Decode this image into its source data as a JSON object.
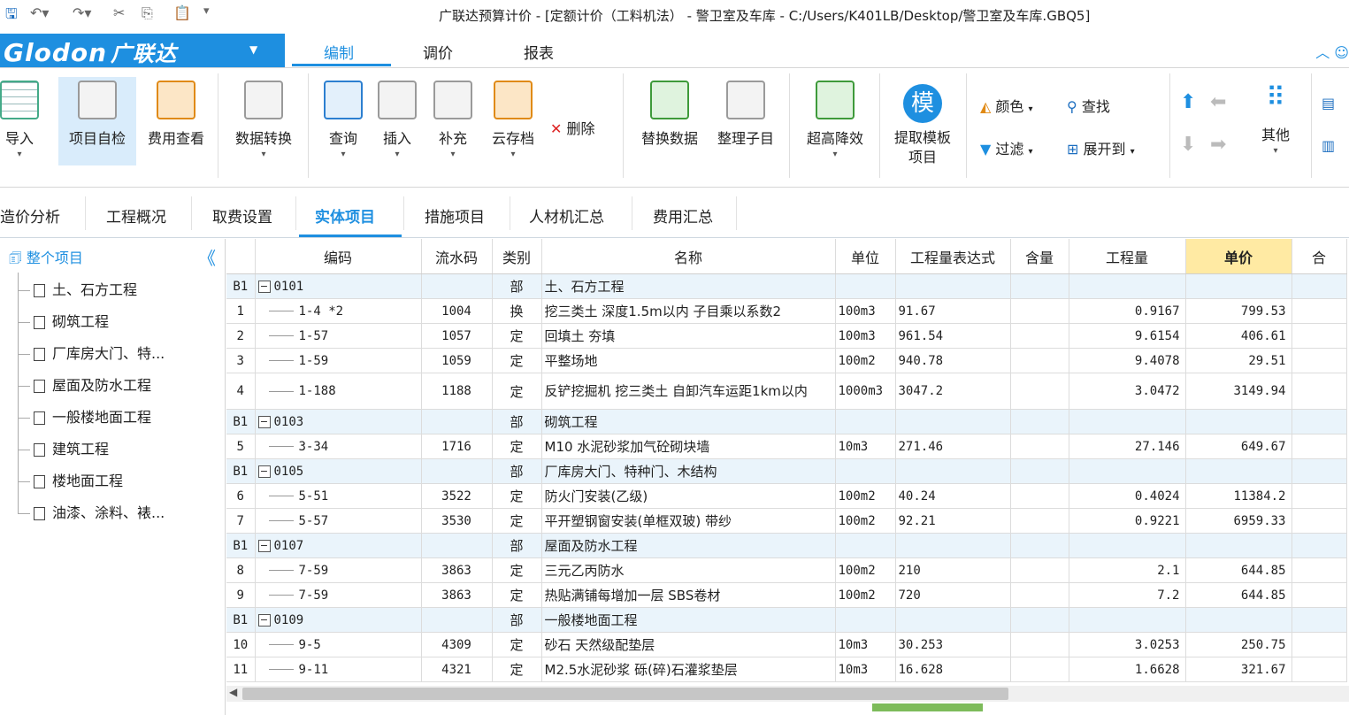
{
  "title": "广联达预算计价 - [定额计价（工料机法） - 警卫室及车库 - C:/Users/K401LB/Desktop/警卫室及车库.GBQ5]",
  "logo": {
    "brand": "Glodon",
    "cn": "广联达"
  },
  "ribbon_tabs": [
    "编制",
    "调价",
    "报表"
  ],
  "toolbar": {
    "import": "导入",
    "self_check": "项目自检",
    "fee_view": "费用查看",
    "data_convert": "数据转换",
    "query": "查询",
    "insert": "插入",
    "supplement": "补充",
    "cloud": "云存档",
    "delete": "删除",
    "replace": "替换数据",
    "organize": "整理子目",
    "ultra_high": "超高降效",
    "template_icon": "模",
    "template": "提取模板项目",
    "color": "颜色",
    "find": "查找",
    "filter": "过滤",
    "expand": "展开到",
    "other": "其他"
  },
  "section_tabs": [
    "造价分析",
    "工程概况",
    "取费设置",
    "实体项目",
    "措施项目",
    "人材机汇总",
    "费用汇总"
  ],
  "tree": {
    "root": "整个项目",
    "items": [
      "土、石方工程",
      "砌筑工程",
      "厂库房大门、特...",
      "屋面及防水工程",
      "一般楼地面工程",
      "建筑工程",
      "楼地面工程",
      "油漆、涂料、裱..."
    ]
  },
  "columns": [
    "编码",
    "流水码",
    "类别",
    "名称",
    "单位",
    "工程量表达式",
    "含量",
    "工程量",
    "单价",
    "合"
  ],
  "rows": [
    {
      "no": "B1",
      "code": "0101",
      "serial": "",
      "type": "部",
      "name": "土、石方工程",
      "unit": "",
      "expr": "",
      "content": "",
      "qty": "",
      "price": "",
      "group": true
    },
    {
      "no": "1",
      "code": "1-4 *2",
      "serial": "1004",
      "type": "换",
      "name": "挖三类土 深度1.5m以内 子目乘以系数2",
      "unit": "100m3",
      "expr": "91.67",
      "content": "",
      "qty": "0.9167",
      "price": "799.53"
    },
    {
      "no": "2",
      "code": "1-57",
      "serial": "1057",
      "type": "定",
      "name": "回填土 夯填",
      "unit": "100m3",
      "expr": "961.54",
      "content": "",
      "qty": "9.6154",
      "price": "406.61"
    },
    {
      "no": "3",
      "code": "1-59",
      "serial": "1059",
      "type": "定",
      "name": "平整场地",
      "unit": "100m2",
      "expr": "940.78",
      "content": "",
      "qty": "9.4078",
      "price": "29.51"
    },
    {
      "no": "4",
      "code": "1-188",
      "serial": "1188",
      "type": "定",
      "name": "反铲挖掘机 挖三类土 自卸汽车运距1km以内",
      "unit": "1000m3",
      "expr": "3047.2",
      "content": "",
      "qty": "3.0472",
      "price": "3149.94",
      "tall": true
    },
    {
      "no": "B1",
      "code": "0103",
      "serial": "",
      "type": "部",
      "name": "砌筑工程",
      "unit": "",
      "expr": "",
      "content": "",
      "qty": "",
      "price": "",
      "group": true
    },
    {
      "no": "5",
      "code": "3-34",
      "serial": "1716",
      "type": "定",
      "name": "M10 水泥砂浆加气砼砌块墙",
      "unit": "10m3",
      "expr": "271.46",
      "content": "",
      "qty": "27.146",
      "price": "649.67"
    },
    {
      "no": "B1",
      "code": "0105",
      "serial": "",
      "type": "部",
      "name": "厂库房大门、特种门、木结构",
      "unit": "",
      "expr": "",
      "content": "",
      "qty": "",
      "price": "",
      "group": true
    },
    {
      "no": "6",
      "code": "5-51",
      "serial": "3522",
      "type": "定",
      "name": "防火门安装(乙级)",
      "unit": "100m2",
      "expr": "40.24",
      "content": "",
      "qty": "0.4024",
      "price": "11384.2"
    },
    {
      "no": "7",
      "code": "5-57",
      "serial": "3530",
      "type": "定",
      "name": "平开塑钢窗安装(单框双玻) 带纱",
      "unit": "100m2",
      "expr": "92.21",
      "content": "",
      "qty": "0.9221",
      "price": "6959.33"
    },
    {
      "no": "B1",
      "code": "0107",
      "serial": "",
      "type": "部",
      "name": "屋面及防水工程",
      "unit": "",
      "expr": "",
      "content": "",
      "qty": "",
      "price": "",
      "group": true
    },
    {
      "no": "8",
      "code": "7-59",
      "serial": "3863",
      "type": "定",
      "name": "三元乙丙防水",
      "unit": "100m2",
      "expr": "210",
      "content": "",
      "qty": "2.1",
      "price": "644.85"
    },
    {
      "no": "9",
      "code": "7-59",
      "serial": "3863",
      "type": "定",
      "name": "热贴满铺每增加一层 SBS卷材",
      "unit": "100m2",
      "expr": "720",
      "content": "",
      "qty": "7.2",
      "price": "644.85"
    },
    {
      "no": "B1",
      "code": "0109",
      "serial": "",
      "type": "部",
      "name": "一般楼地面工程",
      "unit": "",
      "expr": "",
      "content": "",
      "qty": "",
      "price": "",
      "group": true
    },
    {
      "no": "10",
      "code": "9-5",
      "serial": "4309",
      "type": "定",
      "name": "砂石 天然级配垫层",
      "unit": "10m3",
      "expr": "30.253",
      "content": "",
      "qty": "3.0253",
      "price": "250.75"
    },
    {
      "no": "11",
      "code": "9-11",
      "serial": "4321",
      "type": "定",
      "name": "M2.5水泥砂浆 砾(碎)石灌浆垫层",
      "unit": "10m3",
      "expr": "16.628",
      "content": "",
      "qty": "1.6628",
      "price": "321.67"
    }
  ]
}
